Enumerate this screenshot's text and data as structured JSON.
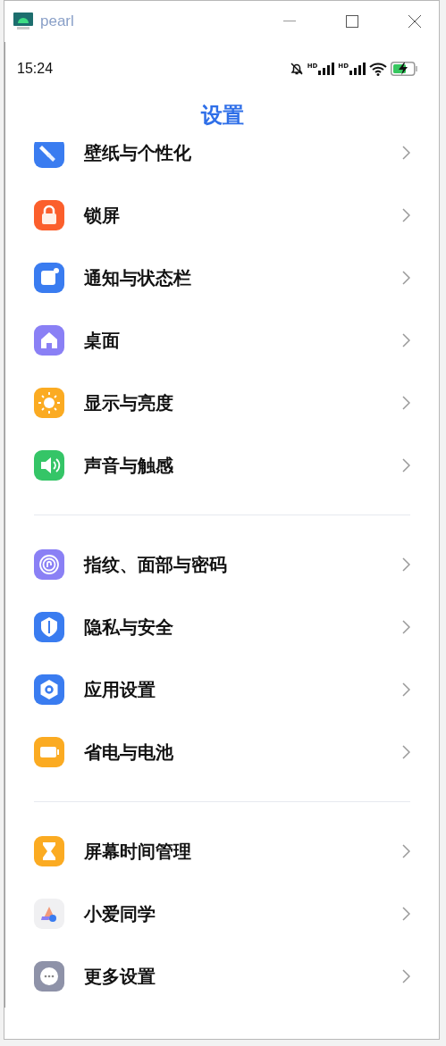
{
  "window": {
    "title": "pearl"
  },
  "status_bar": {
    "time": "15:24",
    "signal_labels": [
      "HD",
      "HD"
    ]
  },
  "header": {
    "title": "设置"
  },
  "groups": [
    {
      "items": [
        {
          "label": "壁纸与个性化",
          "kind": "wallpaper"
        },
        {
          "label": "锁屏",
          "kind": "lock"
        },
        {
          "label": "通知与状态栏",
          "kind": "notification"
        },
        {
          "label": "桌面",
          "kind": "home"
        },
        {
          "label": "显示与亮度",
          "kind": "display"
        },
        {
          "label": "声音与触感",
          "kind": "sound"
        }
      ]
    },
    {
      "items": [
        {
          "label": "指纹、面部与密码",
          "kind": "fingerprint"
        },
        {
          "label": "隐私与安全",
          "kind": "privacy"
        },
        {
          "label": "应用设置",
          "kind": "apps"
        },
        {
          "label": "省电与电池",
          "kind": "battery"
        }
      ]
    },
    {
      "items": [
        {
          "label": "屏幕时间管理",
          "kind": "screentime"
        },
        {
          "label": "小爱同学",
          "kind": "assistant"
        },
        {
          "label": "更多设置",
          "kind": "more"
        }
      ]
    }
  ]
}
